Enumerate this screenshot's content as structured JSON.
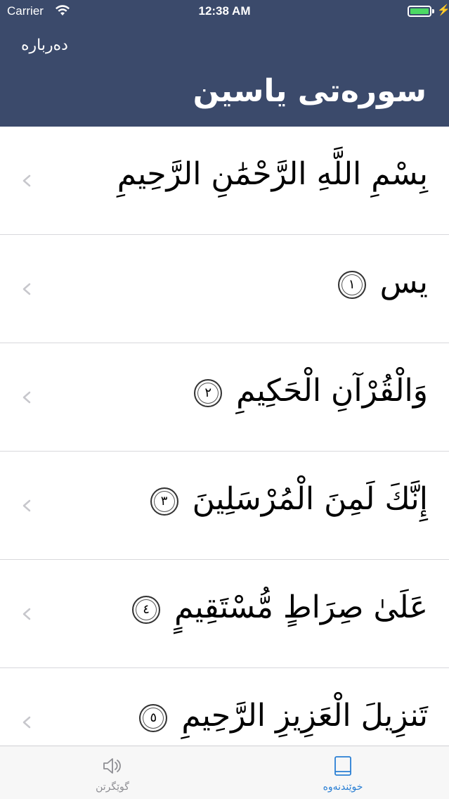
{
  "status_bar": {
    "carrier": "Carrier",
    "time": "12:38 AM",
    "battery_color": "#4cd964"
  },
  "header": {
    "about_label": "دەربارە",
    "title": "سورەتی یاسین",
    "background_color": "#3b4a6b"
  },
  "verses": [
    {
      "text": "بِسْمِ اللَّهِ الرَّحْمَٰنِ الرَّحِيمِ",
      "number": ""
    },
    {
      "text": "يس",
      "number": "١"
    },
    {
      "text": "وَالْقُرْآنِ الْحَكِيمِ",
      "number": "٢"
    },
    {
      "text": "إِنَّكَ لَمِنَ الْمُرْسَلِينَ",
      "number": "٣"
    },
    {
      "text": "عَلَىٰ صِرَاطٍ مُّسْتَقِيمٍ",
      "number": "٤"
    },
    {
      "text": "تَنزِيلَ الْعَزِيزِ الرَّحِيمِ",
      "number": "٥"
    }
  ],
  "tabs": {
    "listen": {
      "label": "گوێگرتن",
      "icon": "speaker-icon"
    },
    "read": {
      "label": "خوێندنەوە",
      "icon": "book-icon"
    }
  },
  "colors": {
    "active_tab": "#2a7fd4",
    "inactive_tab": "#8e8e93"
  }
}
